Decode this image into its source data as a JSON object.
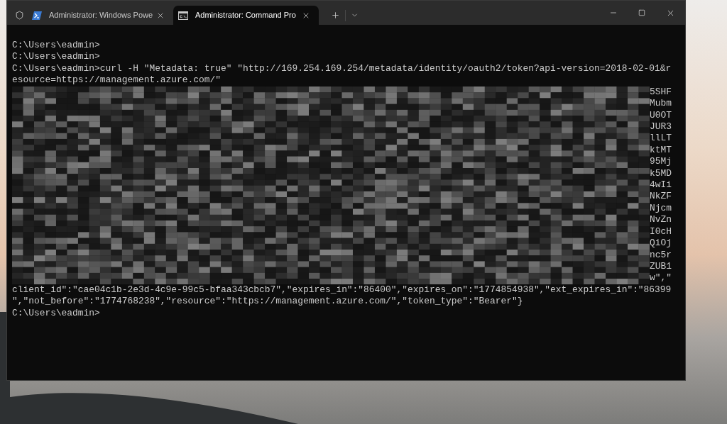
{
  "window": {
    "tabs": [
      {
        "kind": "powershell",
        "title": "Administrator: Windows Powe",
        "selected": false
      },
      {
        "kind": "cmd",
        "title": "Administrator: Command Pro",
        "selected": true
      }
    ]
  },
  "terminal": {
    "lines_before": [
      "C:\\Users\\eadmin>",
      "C:\\Users\\eadmin>",
      "C:\\Users\\eadmin>curl -H \"Metadata: true\" \"http://169.254.169.254/metadata/identity/oauth2/token?api-version=2018-02-01&r",
      "esource=https://management.azure.com/\""
    ],
    "redacted_row_ends": [
      "5SHF",
      "Mubm",
      "U0OT",
      "JUR3",
      "llLT",
      "ktMT",
      "95Mj",
      "k5MD",
      "4wIi",
      "NkZF",
      "Njcm",
      "NvZn",
      "I0cH",
      "QiOj",
      "nc5r",
      "ZUB1",
      "w\",\""
    ],
    "lines_after": [
      "client_id\":\"cae04c1b-2e3d-4c9e-99c5-bfaa343cbcb7\",\"expires_in\":\"86400\",\"expires_on\":\"1774854938\",\"ext_expires_in\":\"86399",
      "\",\"not_before\":\"1774768238\",\"resource\":\"https://management.azure.com/\",\"token_type\":\"Bearer\"}",
      "C:\\Users\\eadmin>"
    ]
  }
}
